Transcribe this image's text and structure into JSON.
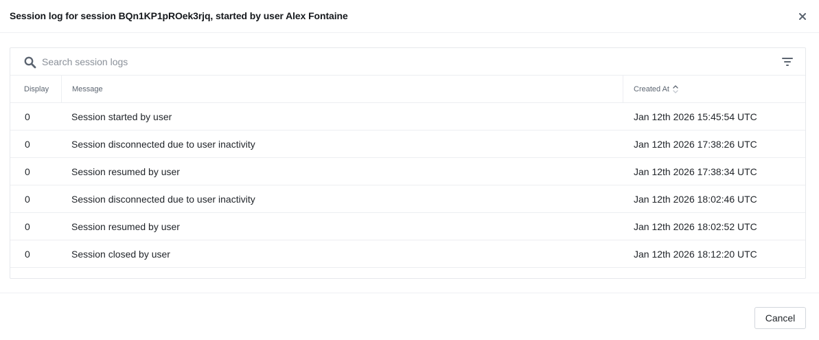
{
  "dialog": {
    "title": "Session log for session BQn1KP1pROek3rjq, started by user Alex Fontaine",
    "close_icon": "close-icon"
  },
  "search": {
    "placeholder": "Search session logs",
    "value": "",
    "icon": "search-icon",
    "filter_icon": "filter-icon"
  },
  "table": {
    "columns": {
      "display": "Display",
      "message": "Message",
      "created_at": "Created At"
    },
    "sort": {
      "column": "created_at",
      "icon": "sort-icon"
    },
    "rows": [
      {
        "display": "0",
        "message": "Session started by user",
        "created_at": "Jan 12th 2026 15:45:54 UTC"
      },
      {
        "display": "0",
        "message": "Session disconnected due to user inactivity",
        "created_at": "Jan 12th 2026 17:38:26 UTC"
      },
      {
        "display": "0",
        "message": "Session resumed by user",
        "created_at": "Jan 12th 2026 17:38:34 UTC"
      },
      {
        "display": "0",
        "message": "Session disconnected due to user inactivity",
        "created_at": "Jan 12th 2026 18:02:46 UTC"
      },
      {
        "display": "0",
        "message": "Session resumed by user",
        "created_at": "Jan 12th 2026 18:02:52 UTC"
      },
      {
        "display": "0",
        "message": "Session closed by user",
        "created_at": "Jan 12th 2026 18:12:20 UTC"
      }
    ]
  },
  "footer": {
    "cancel_label": "Cancel"
  },
  "colors": {
    "border": "#e6e8ec",
    "muted_text": "#5b6470",
    "icon": "#5b6470"
  }
}
